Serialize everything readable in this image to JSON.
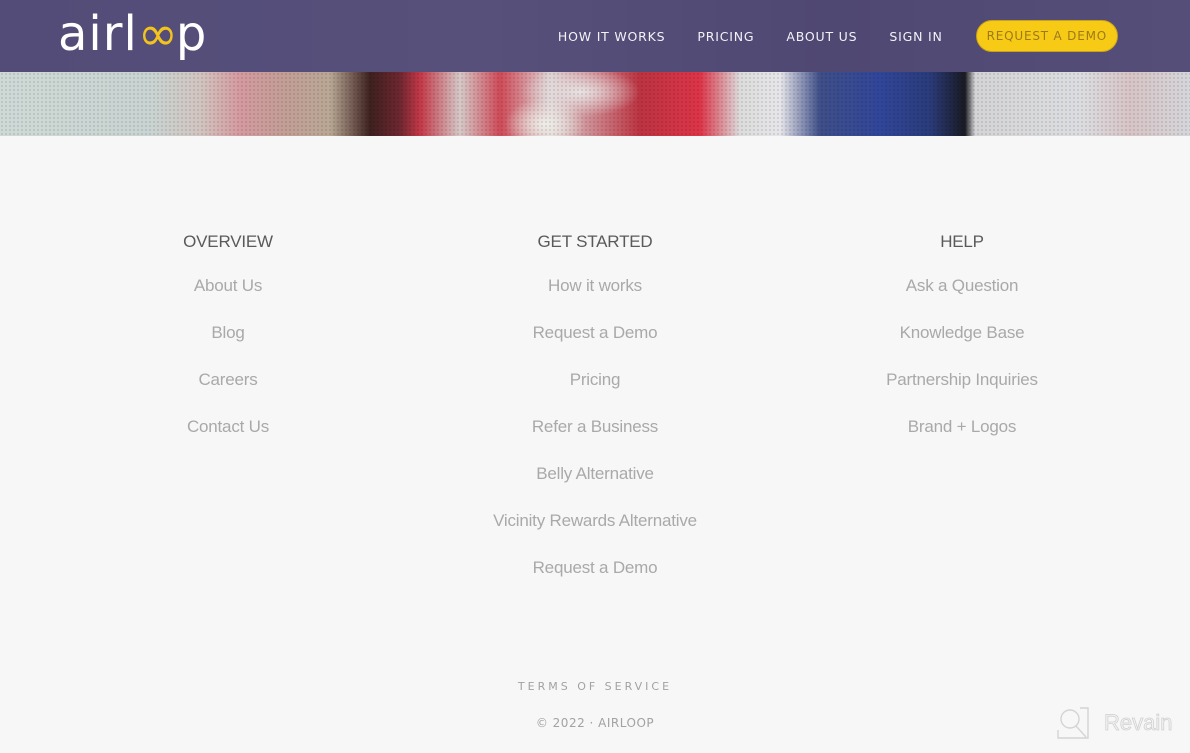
{
  "header": {
    "logo": {
      "text_prefix": "airl",
      "text_loop": "∞",
      "text_suffix": "p",
      "alt": "airloop"
    },
    "nav": [
      {
        "label": "HOW IT WORKS"
      },
      {
        "label": "PRICING"
      },
      {
        "label": "ABOUT US"
      },
      {
        "label": "SIGN IN"
      }
    ],
    "cta_label": "REQUEST A DEMO",
    "colors": {
      "bar": "#544e79",
      "accent": "#f7cb15"
    }
  },
  "footer": {
    "columns": [
      {
        "heading": "OVERVIEW",
        "links": [
          "About Us",
          "Blog",
          "Careers",
          "Contact Us"
        ]
      },
      {
        "heading": "GET STARTED",
        "links": [
          "How it works",
          "Request a Demo",
          "Pricing",
          "Refer a Business",
          "Belly Alternative",
          "Vicinity Rewards Alternative",
          "Request a Demo"
        ]
      },
      {
        "heading": "HELP",
        "links": [
          "Ask a Question",
          "Knowledge Base",
          "Partnership Inquiries",
          "Brand + Logos"
        ]
      }
    ],
    "terms_label": "TERMS OF SERVICE",
    "copyright": "© 2022 · AIRLOOP"
  },
  "watermark": {
    "label": "Revain",
    "icon": "revain-logo-icon"
  }
}
